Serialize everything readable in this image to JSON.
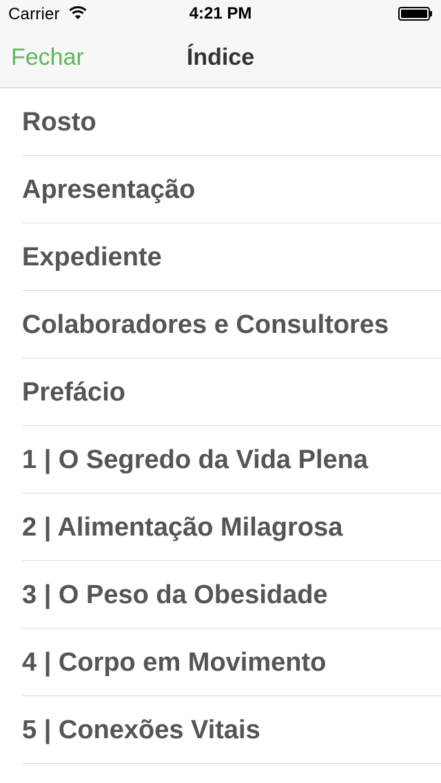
{
  "status_bar": {
    "carrier": "Carrier",
    "time": "4:21 PM",
    "wifi_icon": "wifi-icon",
    "battery_icon": "battery-full-icon"
  },
  "nav": {
    "close_label": "Fechar",
    "title": "Índice",
    "accent_color": "#5cb85c"
  },
  "toc": {
    "items": [
      {
        "label": "Rosto"
      },
      {
        "label": "Apresentação"
      },
      {
        "label": "Expediente"
      },
      {
        "label": "Colaboradores e Consultores"
      },
      {
        "label": "Prefácio"
      },
      {
        "label": "1 | O Segredo da Vida Plena"
      },
      {
        "label": "2 | Alimentação Milagrosa"
      },
      {
        "label": "3 | O Peso da Obesidade"
      },
      {
        "label": "4 | Corpo em Movimento"
      },
      {
        "label": "5 | Conexões Vitais"
      }
    ]
  }
}
